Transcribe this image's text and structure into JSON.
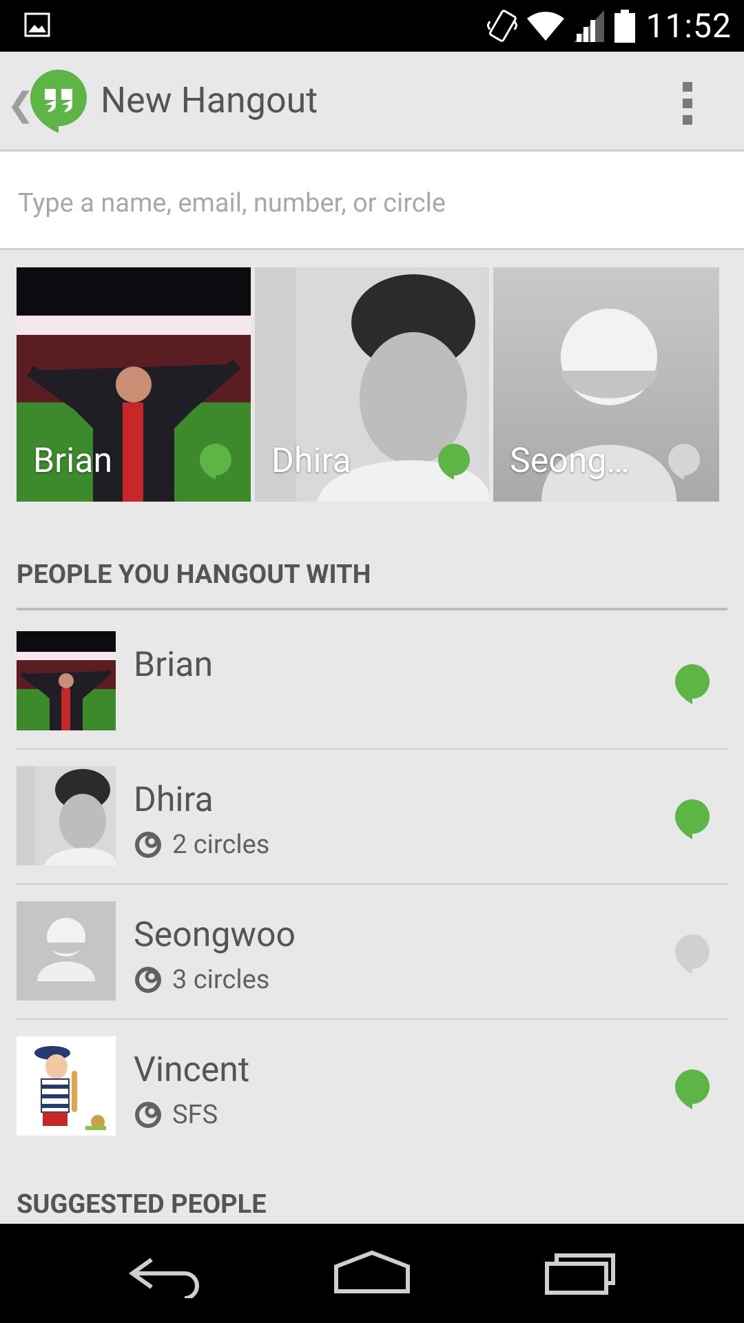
{
  "status_bar": {
    "time": "11:52"
  },
  "app_bar": {
    "back_glyph": "❮",
    "title": "New Hangout"
  },
  "search": {
    "placeholder": "Type a name, email, number, or circle",
    "value": ""
  },
  "tiles": [
    {
      "name": "Brian",
      "online": true
    },
    {
      "name": "Dhira",
      "online": true
    },
    {
      "name": "Seong…",
      "online": false
    }
  ],
  "sections": {
    "frequent_header": "PEOPLE YOU HANGOUT WITH",
    "suggested_header": "SUGGESTED PEOPLE"
  },
  "contacts": [
    {
      "name": "Brian",
      "sub": "",
      "online": true
    },
    {
      "name": "Dhira",
      "sub": "2 circles",
      "online": true
    },
    {
      "name": "Seongwoo",
      "sub": "3 circles",
      "online": false
    },
    {
      "name": "Vincent",
      "sub": "SFS",
      "online": true
    }
  ],
  "colors": {
    "online": "#5cb544",
    "offline": "#d0d0d0",
    "accent": "#5cb544"
  }
}
